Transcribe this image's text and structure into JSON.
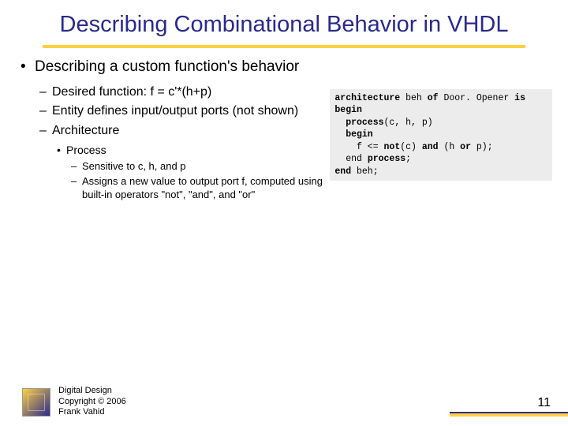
{
  "title": "Describing Combinational Behavior in VHDL",
  "bullets": {
    "l1": "Describing a custom function's behavior",
    "l2a": "Desired function: f = c'*(h+p)",
    "l2b": "Entity defines input/output ports (not shown)",
    "l2c": "Architecture",
    "l3a": "Process",
    "l4a": "Sensitive to c, h, and p",
    "l4b": "Assigns a new value to output port f, computed using built-in operators \"not\", \"and\", and \"or\""
  },
  "code": {
    "line1_pre": "architecture",
    "line1_mid": " beh ",
    "line1_of": "of",
    "line1_name": " Door. Opener ",
    "line1_is": "is",
    "line2": "begin",
    "line3_pre": "  process",
    "line3_args": "(c, h, p)",
    "line4": "  begin",
    "line5_pre": "    f <= ",
    "line5_not": "not",
    "line5_mid1": "(c) ",
    "line5_and": "and",
    "line5_mid2": " (h ",
    "line5_or": "or",
    "line5_end": " p);",
    "line6_pre": "  end ",
    "line6_proc": "process",
    "line6_semi": ";",
    "line7_pre": "end ",
    "line7_name": "beh;"
  },
  "footer": {
    "line1": "Digital Design",
    "line2": "Copyright © 2006",
    "line3": "Frank Vahid"
  },
  "page": "11"
}
